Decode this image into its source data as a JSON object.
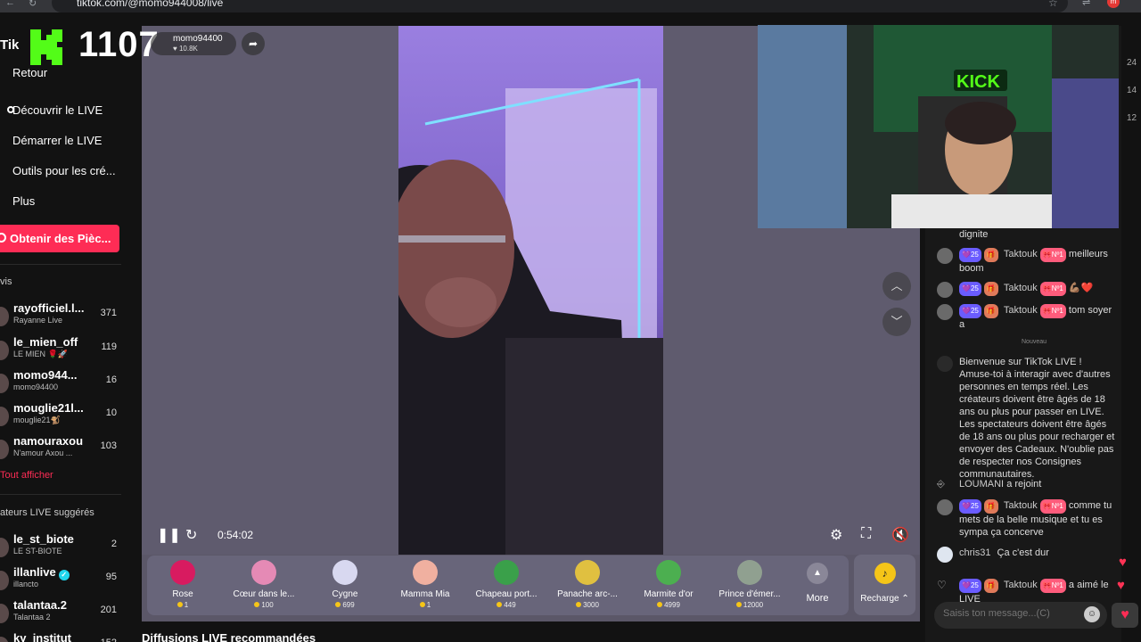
{
  "browser": {
    "url": "tiktok.com/@momo944008/live",
    "profile_initial": "m"
  },
  "overlay": {
    "kick_count": "1107"
  },
  "sidebar": {
    "logo_fragment": "Tik",
    "nav": [
      {
        "label": "Retour"
      },
      {
        "label": "Découvrir le LIVE"
      },
      {
        "label": "Démarrer le LIVE"
      },
      {
        "label": "Outils pour les cré..."
      },
      {
        "label": "Plus"
      }
    ],
    "coins_button": "Obtenir des Pièc...",
    "following_label": "vis",
    "accounts": [
      {
        "name": "rayofficiel.l...",
        "sub": "Rayanne Live",
        "count": "371"
      },
      {
        "name": "le_mien_off",
        "sub": "LE MIEN 🌹🚀",
        "count": "119"
      },
      {
        "name": "momo944...",
        "sub": "momo94400",
        "count": "16"
      },
      {
        "name": "mouglie21l...",
        "sub": "mouglie21🐒",
        "count": "10"
      },
      {
        "name": "namouraxou",
        "sub": "N'amour Axou ...",
        "count": "103"
      }
    ],
    "show_all": "Tout afficher",
    "suggested_label": "ateurs LIVE suggérés",
    "suggested": [
      {
        "name": "le_st_biote",
        "sub": "LE ST-BIOTE",
        "count": "2"
      },
      {
        "name": "illanlive",
        "sub": "illancto",
        "count": "95"
      },
      {
        "name": "talantaa.2",
        "sub": "Talantaa 2",
        "count": "201"
      },
      {
        "name": "ky_institut",
        "sub": "",
        "count": "152"
      }
    ]
  },
  "live": {
    "host_name": "momo94400",
    "host_likes": "♥ 10.8K",
    "elapsed": "0:54:02"
  },
  "gifts": [
    {
      "name": "Rose",
      "price": "1",
      "color": "#d81b60"
    },
    {
      "name": "Cœur dans le...",
      "price": "100",
      "color": "#e58ab5"
    },
    {
      "name": "Cygne",
      "price": "699",
      "color": "#d8d8f0"
    },
    {
      "name": "Mamma Mia",
      "price": "1",
      "color": "#f0b0a0"
    },
    {
      "name": "Chapeau port...",
      "price": "449",
      "color": "#3aa04a"
    },
    {
      "name": "Panache arc-...",
      "price": "3000",
      "color": "#e0c040"
    },
    {
      "name": "Marmite d'or",
      "price": "4999",
      "color": "#4caf50"
    },
    {
      "name": "Prince d'émer...",
      "price": "12000",
      "color": "#90a090"
    }
  ],
  "gift_bar": {
    "more_label": "More",
    "recharge_label": "Recharge ⌃"
  },
  "bottom_heading": "Diffusions LIVE recommandées",
  "side_numbers": [
    "24",
    "14",
    "12"
  ],
  "chat": {
    "top_text": "dignite",
    "messages": [
      {
        "level": "💜25",
        "fan": "🎀Nº1",
        "user": "Taktouk",
        "text": "meilleurs boom"
      },
      {
        "level": "💜25",
        "fan": "🎀Nº1",
        "user": "Taktouk",
        "text": "💪🏽❤️"
      },
      {
        "level": "💜25",
        "fan": "🎀Nº1",
        "user": "Taktouk",
        "text": "tom soyer a"
      }
    ],
    "new_label": "Nouveau",
    "welcome": "Bienvenue sur TikTok LIVE ! Amuse-toi à interagir avec d'autres personnes en temps réel. Les créateurs doivent être âgés de 18 ans ou plus pour passer en LIVE. Les spectateurs doivent être âgés de 18 ans ou plus pour recharger et envoyer des Cadeaux. N'oublie pas de respecter nos Consignes communautaires.",
    "join_user": "LOUMANI",
    "join_text": "a rejoint",
    "msg4": {
      "level": "💜25",
      "fan": "🎀Nº1",
      "user": "Taktouk",
      "text": "comme tu mets de la belle musique et tu es sympa ça concerve"
    },
    "msg5": {
      "user": "chris31",
      "text": "Ça c'est dur"
    },
    "msg6": {
      "level": "💜25",
      "fan": "🎀Nº1",
      "user": "Taktouk",
      "text": "a aimé le LIVE"
    },
    "input_placeholder": "Saisis ton message...(C)"
  }
}
